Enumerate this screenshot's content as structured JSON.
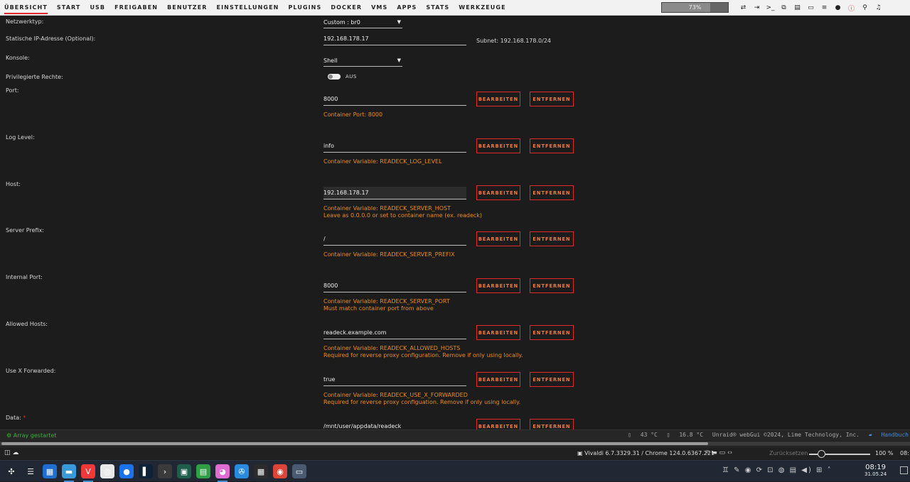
{
  "nav": {
    "items": [
      "ÜBERSICHT",
      "START",
      "USB",
      "FREIGABEN",
      "BENUTZER",
      "EINSTELLUNGEN",
      "PLUGINS",
      "DOCKER",
      "VMS",
      "APPS",
      "STATS",
      "WERKZEUGE"
    ],
    "active_index": 0,
    "progress_label": "73%",
    "progress_value": 0.73
  },
  "toolbar_icons": [
    "switch-icon",
    "logout-icon",
    "terminal-icon",
    "copy-icon",
    "feedback-icon",
    "monitor-icon",
    "menu-icon",
    "help-icon",
    "alert-icon",
    "search-icon",
    "bell-icon"
  ],
  "form": {
    "network": {
      "label": "Netzwerktyp:",
      "value": "Custom : br0"
    },
    "ip": {
      "label": "Statische IP-Adresse (Optional):",
      "value": "192.168.178.17",
      "subnet": "Subnet: 192.168.178.0/24"
    },
    "console": {
      "label": "Konsole:",
      "value": "Shell"
    },
    "privileged": {
      "label": "Privilegierte Rechte:",
      "state": "AUS"
    },
    "edit_label": "BEARBEITEN",
    "remove_label": "ENTFERNEN",
    "fields": [
      {
        "label": "Port:",
        "value": "8000",
        "hint1": "Container Port: 8000",
        "hint2": ""
      },
      {
        "label": "Log Level:",
        "value": "info",
        "hint1": "Container Variable: READECK_LOG_LEVEL",
        "hint2": ""
      },
      {
        "label": "Host:",
        "value": "192.168.178.17",
        "hint1": "Container Variable: READECK_SERVER_HOST",
        "hint2": "Leave as 0.0.0.0 or set to container name (ex. readeck)"
      },
      {
        "label": "Server Prefix:",
        "value": "/",
        "hint1": "Container Variable: READECK_SERVER_PREFIX",
        "hint2": ""
      },
      {
        "label": "Internal Port:",
        "value": "8000",
        "hint1": "Container Variable: READECK_SERVER_PORT",
        "hint2": "Must match container port from above"
      },
      {
        "label": "Allowed Hosts:",
        "value": "readeck.example.com",
        "hint1": "Container Variable: READECK_ALLOWED_HOSTS",
        "hint2": "Required for reverse proxy configuration. Remove if only using locally."
      },
      {
        "label": "Use X Forwarded:",
        "value": "true",
        "hint1": "Container Variable: READECK_USE_X_FORWARDED",
        "hint2": "Required for reverse proxy configuation. Remove if only using locally."
      },
      {
        "label": "Data:",
        "required_mark": "*",
        "value": "/mnt/user/appdata/readeck",
        "hint1": "",
        "hint2": ""
      }
    ]
  },
  "footer": {
    "array_status": "Array gestartet",
    "temp1": "43 °C",
    "temp2": "16.8 °C",
    "copyright": "Unraid® webGui ©2024, Lime Technology, Inc.",
    "manual": "Handbuch"
  },
  "browser": {
    "version": "Vivaldi 6.7.3329.31 / Chrome 124.0.6367.221",
    "reset": "Zurücksetzen",
    "zoom": "100 %",
    "time_cut": "08:1"
  },
  "taskbar": {
    "apps": [
      {
        "name": "app-launcher",
        "bg": "transparent",
        "glyph": "✣"
      },
      {
        "name": "settings-app",
        "bg": "transparent",
        "glyph": "☰"
      },
      {
        "name": "store-app",
        "bg": "#1f6fd1",
        "glyph": "▦"
      },
      {
        "name": "files-app",
        "bg": "#3a9ad9",
        "glyph": "▬"
      },
      {
        "name": "vivaldi-app",
        "bg": "#ef3939",
        "glyph": "V"
      },
      {
        "name": "sync-app",
        "bg": "#e8e8e8",
        "glyph": "◎"
      },
      {
        "name": "droplet-app",
        "bg": "#1a73e8",
        "glyph": "●"
      },
      {
        "name": "terminal-dark-app",
        "bg": "#0e2238",
        "glyph": "▌"
      },
      {
        "name": "console-app",
        "bg": "#3b3b3b",
        "glyph": "›"
      },
      {
        "name": "media-app",
        "bg": "#1e5e4a",
        "glyph": "▣"
      },
      {
        "name": "sheets-app",
        "bg": "#2f9e44",
        "glyph": "▤"
      },
      {
        "name": "paint-app",
        "bg": "#e06bd1",
        "glyph": "◕"
      },
      {
        "name": "kdeconnect-app",
        "bg": "#2a8ae0",
        "glyph": "✇"
      },
      {
        "name": "calculator-app",
        "bg": "#2b2b2b",
        "glyph": "▦"
      },
      {
        "name": "chrome-app",
        "bg": "#db4437",
        "glyph": "◉"
      },
      {
        "name": "screenshot-app",
        "bg": "#4a5a70",
        "glyph": "▭"
      }
    ],
    "tray": "♊ ✎ ◉ ⟳ ⊡ ◍ ▤ ◀) ⊞ ˄",
    "time": "08:19",
    "date": "31.05.24"
  }
}
